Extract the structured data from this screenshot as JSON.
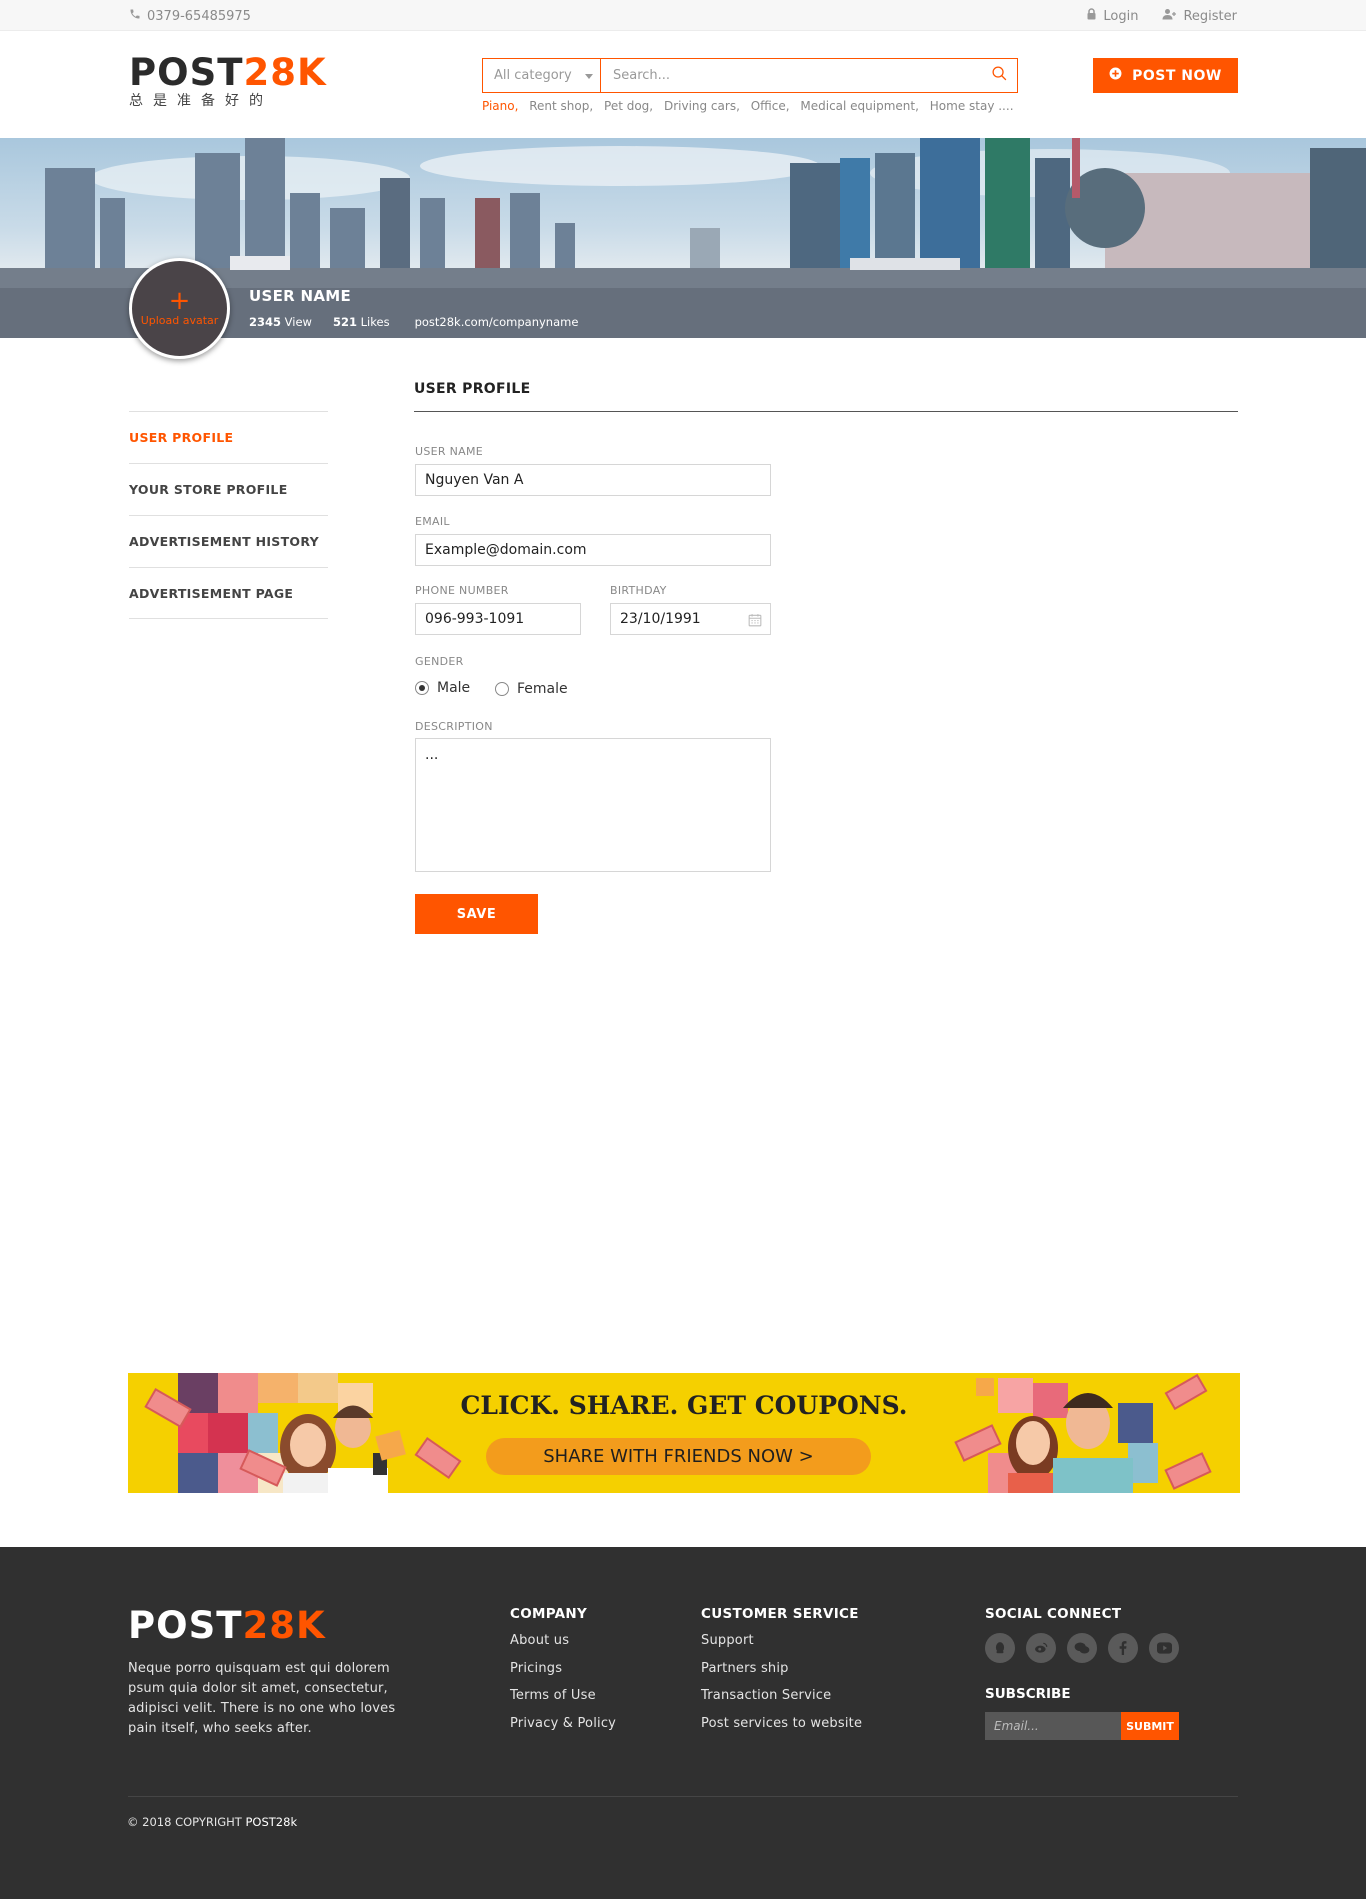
{
  "topbar": {
    "phone": "0379-65485975",
    "login": "Login",
    "register": "Register"
  },
  "header": {
    "logo_dark": "POST",
    "logo_accent": "28K",
    "logo_tagline": "总是准备好的",
    "category": "All category",
    "search_placeholder": "Search...",
    "suggestions": [
      "Piano,",
      "Rent shop,",
      "Pet dog,",
      "Driving cars,",
      "Office,",
      "Medical equipment,",
      "Home stay ...."
    ],
    "post_now": "POST NOW"
  },
  "profile_banner": {
    "upload_avatar": "Upload avatar",
    "user_name": "USER NAME",
    "views_count": "2345",
    "views_label": "View",
    "likes_count": "521",
    "likes_label": "Likes",
    "url": "post28k.com/companyname"
  },
  "sidebar": {
    "items": [
      {
        "label": "USER PROFILE"
      },
      {
        "label": "YOUR STORE  PROFILE"
      },
      {
        "label": "ADVERTISEMENT HISTORY"
      },
      {
        "label": "ADVERTISEMENT PAGE"
      }
    ]
  },
  "form": {
    "title": "USER PROFILE",
    "username_label": "USER NAME",
    "username_value": "Nguyen Van A",
    "email_label": "EMAIL",
    "email_value": "Example@domain.com",
    "phone_label": "PHONE NUMBER",
    "phone_value": "096-993-1091",
    "birthday_label": "BIRTHDAY",
    "birthday_value": "23/10/1991",
    "gender_label": "GENDER",
    "gender_male": "Male",
    "gender_female": "Female",
    "description_label": "DESCRIPTION",
    "description_value": "...",
    "save": "SAVE"
  },
  "promo": {
    "headline": "CLICK. SHARE. GET COUPONS.",
    "cta": "SHARE WITH FRIENDS NOW  >",
    "colors": {
      "background": "#f5d000",
      "button": "#f39c1c"
    }
  },
  "footer": {
    "logo_light": "POST",
    "logo_accent": "28K",
    "description": "Neque porro quisquam est qui dolorem psum quia dolor sit amet, consectetur, adipisci velit. There is no one who loves pain itself, who seeks after.",
    "company": {
      "title": "COMPANY",
      "links": [
        "About us",
        "Pricings",
        "Terms of Use",
        "Privacy & Policy"
      ]
    },
    "customer_service": {
      "title": "CUSTOMER SERVICE",
      "links": [
        "Support",
        "Partners ship",
        "Transaction Service",
        "Post services to website"
      ]
    },
    "social": {
      "title": "SOCIAL CONNECT",
      "icons": [
        "qq-icon",
        "weibo-icon",
        "wechat-icon",
        "facebook-icon",
        "youtube-icon"
      ]
    },
    "subscribe": {
      "title": "SUBSCRIBE",
      "placeholder": "Email...",
      "button": "SUBMIT"
    },
    "copyright_prefix": "© 2018 COPYRIGHT",
    "copyright_brand": "POST28k"
  },
  "colors": {
    "accent": "#ff5500",
    "footer_bg": "#303030"
  }
}
